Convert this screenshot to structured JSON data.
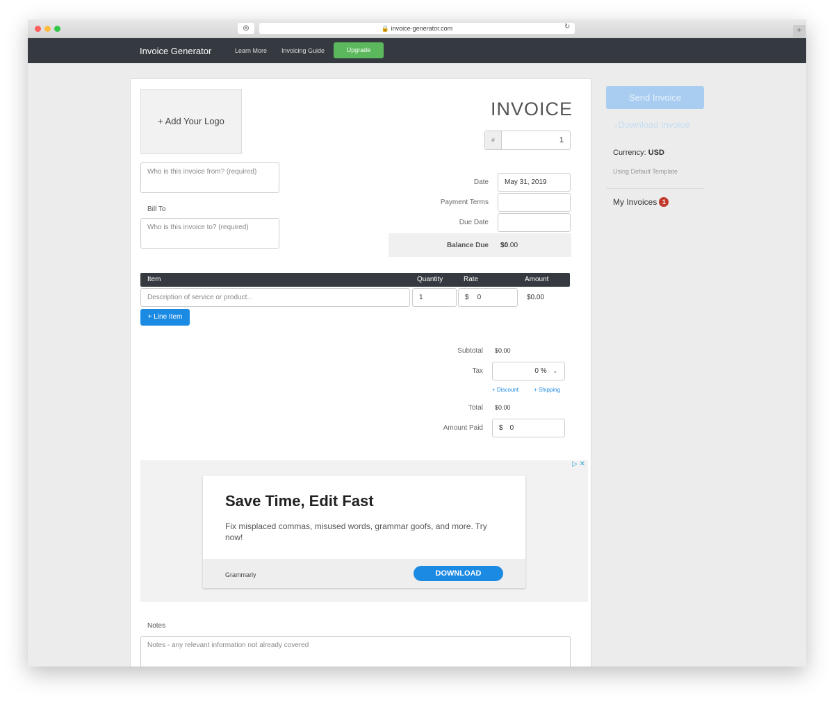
{
  "browser": {
    "url": "invoice-generator.com"
  },
  "nav": {
    "brand": "Invoice Generator",
    "links": [
      "Learn More",
      "Invoicing Guide"
    ],
    "upgrade": "Upgrade"
  },
  "invoice": {
    "add_logo": "+ Add Your Logo",
    "title": "INVOICE",
    "number_prefix": "#",
    "number": "1",
    "from_placeholder": "Who is this invoice from? (required)",
    "bill_to": "Bill To",
    "to_placeholder": "Who is this invoice to? (required)",
    "date_label": "Date",
    "date": "May 31, 2019",
    "terms_label": "Payment Terms",
    "due_label": "Due Date",
    "balance_label": "Balance Due",
    "balance_sym": "$",
    "balance_int": "0",
    "balance_dec": ".00"
  },
  "items": {
    "headers": [
      "Item",
      "Quantity",
      "Rate",
      "Amount"
    ],
    "desc_placeholder": "Description of service or product...",
    "qty": "1",
    "rate_sym": "$",
    "rate": "0",
    "amount": "$0.00",
    "add_line": "+ Line Item"
  },
  "totals": {
    "subtotal_label": "Subtotal",
    "subtotal": "$0.00",
    "tax_label": "Tax",
    "tax": "0 %",
    "discount": "+ Discount",
    "shipping": "+ Shipping",
    "total_label": "Total",
    "total": "$0.00",
    "paid_label": "Amount Paid",
    "paid_sym": "$",
    "paid": "0"
  },
  "ad": {
    "title": "Save Time, Edit Fast",
    "body": "Fix misplaced commas, misused words, grammar goofs, and more. Try now!",
    "brand": "Grammarly",
    "cta": "DOWNLOAD"
  },
  "notes": {
    "label": "Notes",
    "placeholder": "Notes - any relevant information not already covered"
  },
  "sidebar": {
    "send": "Send Invoice",
    "download": "Download Invoice",
    "currency_label": "Currency:",
    "currency": "USD",
    "template": "Using Default Template",
    "my_invoices": "My Invoices",
    "count": "1"
  },
  "colors": {
    "nav": "#343a40",
    "upgrade": "#5cb85c",
    "primary": "#1b8ae3",
    "badge": "#c0392b"
  }
}
